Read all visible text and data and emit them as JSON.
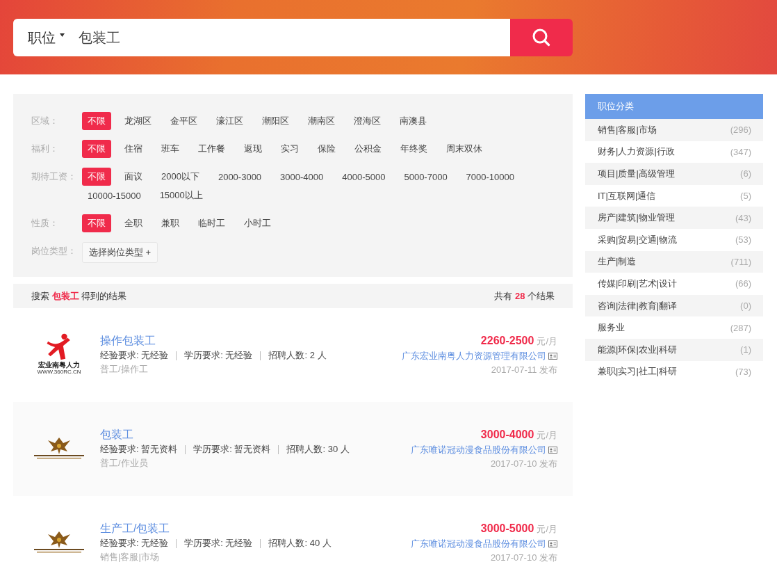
{
  "search": {
    "category": "职位",
    "query": "包装工"
  },
  "filters": [
    {
      "label": "区域：",
      "options": [
        {
          "label": "不限",
          "selected": true
        },
        {
          "label": "龙湖区",
          "selected": false
        },
        {
          "label": "金平区",
          "selected": false
        },
        {
          "label": "濠江区",
          "selected": false
        },
        {
          "label": "潮阳区",
          "selected": false
        },
        {
          "label": "潮南区",
          "selected": false
        },
        {
          "label": "澄海区",
          "selected": false
        },
        {
          "label": "南澳县",
          "selected": false
        }
      ]
    },
    {
      "label": "福利：",
      "options": [
        {
          "label": "不限",
          "selected": true
        },
        {
          "label": "住宿",
          "selected": false
        },
        {
          "label": "班车",
          "selected": false
        },
        {
          "label": "工作餐",
          "selected": false
        },
        {
          "label": "返现",
          "selected": false
        },
        {
          "label": "实习",
          "selected": false
        },
        {
          "label": "保险",
          "selected": false
        },
        {
          "label": "公积金",
          "selected": false
        },
        {
          "label": "年终奖",
          "selected": false
        },
        {
          "label": "周末双休",
          "selected": false
        }
      ]
    },
    {
      "label": "期待工资：",
      "options": [
        {
          "label": "不限",
          "selected": true
        },
        {
          "label": "面议",
          "selected": false
        },
        {
          "label": "2000以下",
          "selected": false
        },
        {
          "label": "2000-3000",
          "selected": false
        },
        {
          "label": "3000-4000",
          "selected": false
        },
        {
          "label": "4000-5000",
          "selected": false
        },
        {
          "label": "5000-7000",
          "selected": false
        },
        {
          "label": "7000-10000",
          "selected": false
        },
        {
          "label": "10000-15000",
          "selected": false
        },
        {
          "label": "15000以上",
          "selected": false
        }
      ]
    },
    {
      "label": "性质：",
      "options": [
        {
          "label": "不限",
          "selected": true
        },
        {
          "label": "全职",
          "selected": false
        },
        {
          "label": "兼职",
          "selected": false
        },
        {
          "label": "临时工",
          "selected": false
        },
        {
          "label": "小时工",
          "selected": false
        }
      ]
    }
  ],
  "job_type": {
    "label": "岗位类型：",
    "button": "选择岗位类型 +"
  },
  "results": {
    "summary": "搜索 **包装工** 得到的结果",
    "total_prefix": "共有",
    "total": "28",
    "total_suffix": "个结果"
  },
  "jobs": [
    {
      "kind": "person",
      "logo_text": "宏业南粤人力",
      "logo_url": "WWW.360RC.CN",
      "title": "操作包装工",
      "experience": "经验要求: 无经验",
      "education": "学历要求: 无经验",
      "headcount": "招聘人数: 2 人",
      "category": "普工/操作工",
      "salary": "2260-2500",
      "salary_unit": "元/月",
      "company": "广东宏业南粤人力资源管理有限公司",
      "date": "2017-07-11 发布"
    },
    {
      "kind": "emblem",
      "title": "包装工",
      "experience": "经验要求: 暂无资料",
      "education": "学历要求: 暂无资料",
      "headcount": "招聘人数: 30 人",
      "category": "普工/作业员",
      "salary": "3000-4000",
      "salary_unit": "元/月",
      "company": "广东唯诺冠动漫食品股份有限公司",
      "date": "2017-07-10 发布"
    },
    {
      "kind": "emblem",
      "title": "生产工/包装工",
      "experience": "经验要求: 无经验",
      "education": "学历要求: 无经验",
      "headcount": "招聘人数: 40 人",
      "category": "销售|客服|市场",
      "salary": "3000-5000",
      "salary_unit": "元/月",
      "company": "广东唯诺冠动漫食品股份有限公司",
      "date": "2017-07-10 发布"
    }
  ],
  "sidebar": {
    "title": "职位分类",
    "items": [
      {
        "label": "销售|客服|市场",
        "count": "(296)"
      },
      {
        "label": "财务|人力资源|行政",
        "count": "(347)"
      },
      {
        "label": "项目|质量|高级管理",
        "count": "(6)"
      },
      {
        "label": "IT|互联网|通信",
        "count": "(5)"
      },
      {
        "label": "房产|建筑|物业管理",
        "count": "(43)"
      },
      {
        "label": "采购|贸易|交通|物流",
        "count": "(53)"
      },
      {
        "label": "生产|制造",
        "count": "(711)"
      },
      {
        "label": "传媒|印刷|艺术|设计",
        "count": "(66)"
      },
      {
        "label": "咨询|法律|教育|翻译",
        "count": "(0)"
      },
      {
        "label": "服务业",
        "count": "(287)"
      },
      {
        "label": "能源|环保|农业|科研",
        "count": "(1)"
      },
      {
        "label": "兼职|实习|社工|科研",
        "count": "(73)"
      }
    ]
  }
}
